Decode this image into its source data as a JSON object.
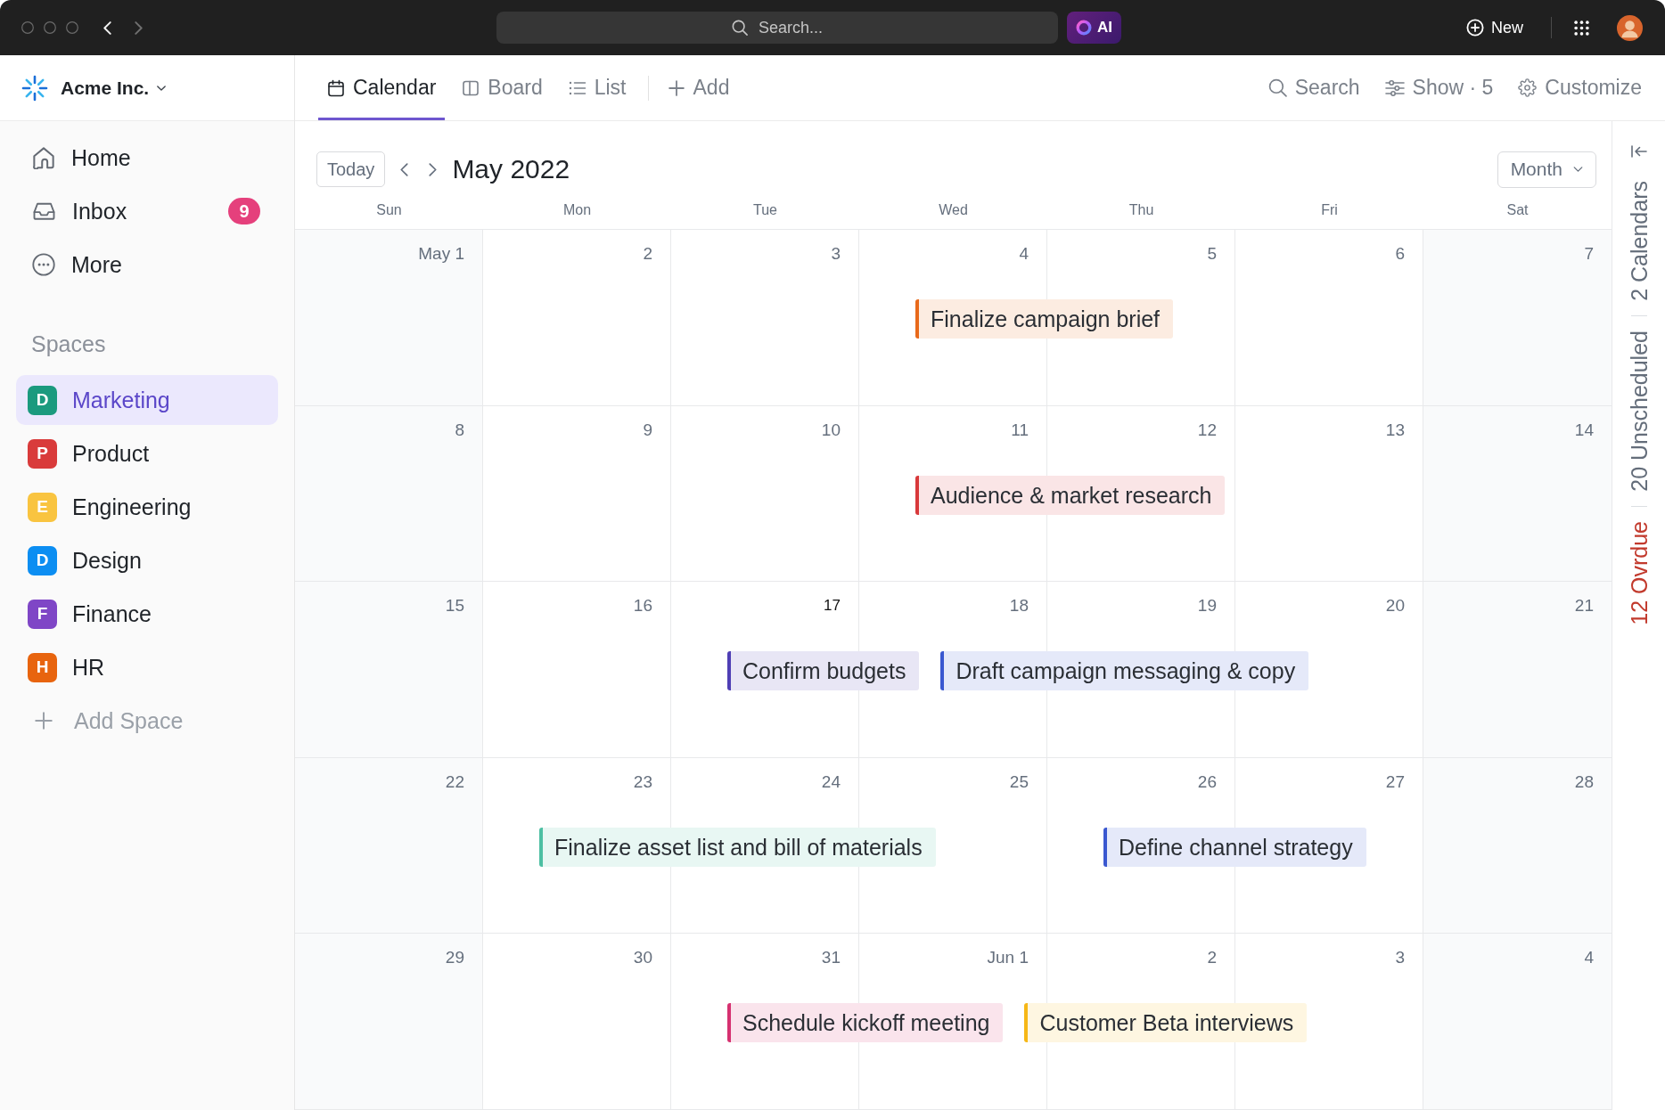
{
  "topbar": {
    "nav": [
      {
        "kind": "back",
        "disabled": false
      },
      {
        "kind": "forward",
        "disabled": true
      }
    ],
    "search": {
      "placeholder": "Search..."
    },
    "ai_button": "AI",
    "new_button": "New"
  },
  "sidebar": {
    "workspace": "Acme Inc.",
    "nav": [
      {
        "kind": "home",
        "label": "Home"
      },
      {
        "kind": "inbox",
        "label": "Inbox",
        "badge": "9"
      },
      {
        "kind": "more",
        "label": "More"
      }
    ],
    "spaces_title": "Spaces",
    "spaces": [
      {
        "initial": "D",
        "label": "Marketing",
        "color": "#1b9a7e",
        "selected": true
      },
      {
        "initial": "P",
        "label": "Product",
        "color": "#d93b3b",
        "selected": false
      },
      {
        "initial": "E",
        "label": "Engineering",
        "color": "#f9c440",
        "selected": false
      },
      {
        "initial": "D",
        "label": "Design",
        "color": "#0c8ef2",
        "selected": false
      },
      {
        "initial": "F",
        "label": "Finance",
        "color": "#7f46c6",
        "selected": false
      },
      {
        "initial": "H",
        "label": "HR",
        "color": "#e8640e",
        "selected": false
      }
    ],
    "add_space": "Add Space"
  },
  "views": {
    "tabs": [
      {
        "kind": "calendar",
        "label": "Calendar",
        "selected": true
      },
      {
        "kind": "board",
        "label": "Board",
        "selected": false
      },
      {
        "kind": "list",
        "label": "List",
        "selected": false
      }
    ],
    "add": "Add",
    "actions": [
      {
        "kind": "search",
        "label": "Search"
      },
      {
        "kind": "show",
        "label": "Show · 5"
      },
      {
        "kind": "customize",
        "label": "Customize"
      }
    ]
  },
  "calendar": {
    "today_button": "Today",
    "title": "May 2022",
    "view_select": "Month",
    "weekdays": [
      "Sun",
      "Mon",
      "Tue",
      "Wed",
      "Thu",
      "Fri",
      "Sat"
    ],
    "weeks": [
      {
        "days": [
          {
            "label": "May 1",
            "today": false
          },
          {
            "label": "2",
            "today": false
          },
          {
            "label": "3",
            "today": false
          },
          {
            "label": "4",
            "today": false,
            "events": [
              {
                "title": "Finalize campaign brief",
                "color": "#e8691a"
              }
            ]
          },
          {
            "label": "5",
            "today": false
          },
          {
            "label": "6",
            "today": false
          },
          {
            "label": "7",
            "today": false
          }
        ]
      },
      {
        "days": [
          {
            "label": "8",
            "today": false
          },
          {
            "label": "9",
            "today": false
          },
          {
            "label": "10",
            "today": false
          },
          {
            "label": "11",
            "today": false,
            "events": [
              {
                "title": "Audience & market research",
                "color": "#d8393b"
              }
            ]
          },
          {
            "label": "12",
            "today": false
          },
          {
            "label": "13",
            "today": false
          },
          {
            "label": "14",
            "today": false
          }
        ]
      },
      {
        "days": [
          {
            "label": "15",
            "today": false
          },
          {
            "label": "16",
            "today": false
          },
          {
            "label": "17",
            "today": true,
            "events": [
              {
                "title": "Confirm budgets",
                "color": "#4f3fb5"
              }
            ]
          },
          {
            "label": "18",
            "today": false,
            "events": [
              {
                "title": "Draft campaign messaging & copy",
                "color": "#3a58d0"
              }
            ]
          },
          {
            "label": "19",
            "today": false
          },
          {
            "label": "20",
            "today": false
          },
          {
            "label": "21",
            "today": false
          }
        ]
      },
      {
        "days": [
          {
            "label": "22",
            "today": false
          },
          {
            "label": "23",
            "today": false,
            "events": [
              {
                "title": "Finalize asset list and bill of materials",
                "color": "#4dbfa3"
              }
            ]
          },
          {
            "label": "24",
            "today": false
          },
          {
            "label": "25",
            "today": false
          },
          {
            "label": "26",
            "today": false,
            "events": [
              {
                "title": "Define channel strategy",
                "color": "#3a58d0"
              }
            ]
          },
          {
            "label": "27",
            "today": false
          },
          {
            "label": "28",
            "today": false
          }
        ]
      },
      {
        "days": [
          {
            "label": "29",
            "today": false
          },
          {
            "label": "30",
            "today": false
          },
          {
            "label": "31",
            "today": false,
            "events": [
              {
                "title": "Schedule kickoff meeting",
                "color": "#d63170"
              }
            ]
          },
          {
            "label": "Jun 1",
            "today": false,
            "events": [
              {
                "title": "Customer Beta interviews",
                "color": "#f6b716"
              }
            ]
          },
          {
            "label": "2",
            "today": false
          },
          {
            "label": "3",
            "today": false
          },
          {
            "label": "4",
            "today": false
          }
        ]
      }
    ]
  },
  "rail": {
    "items": [
      {
        "kind": "count",
        "label": "2 Calendars"
      },
      {
        "kind": "count",
        "label": "20 Unscheduled"
      },
      {
        "kind": "overdue",
        "label": "12 Ovrdue"
      }
    ]
  }
}
